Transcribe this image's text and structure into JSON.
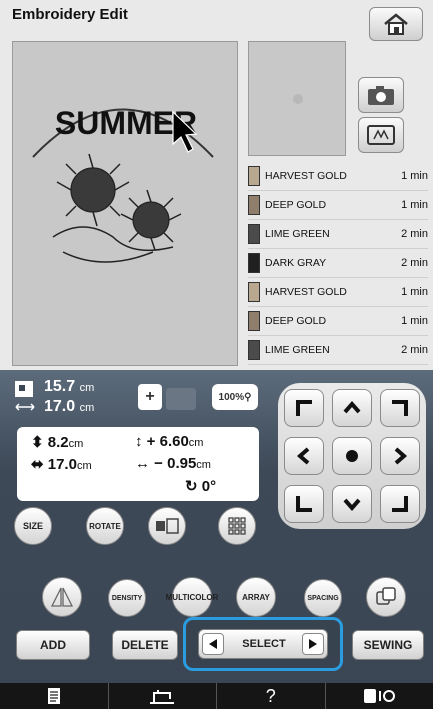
{
  "header": {
    "title": "Embroidery Edit"
  },
  "canvas": {
    "design_text": "SUMMER"
  },
  "threads": [
    {
      "name": "HARVEST GOLD",
      "time": "1 min",
      "color": "#b9a890"
    },
    {
      "name": "DEEP GOLD",
      "time": "1 min",
      "color": "#8e7e6b"
    },
    {
      "name": "LIME GREEN",
      "time": "2 min",
      "color": "#4b4b4b"
    },
    {
      "name": "DARK GRAY",
      "time": "2 min",
      "color": "#202020"
    },
    {
      "name": "HARVEST GOLD",
      "time": "1 min",
      "color": "#b9a890"
    },
    {
      "name": "DEEP GOLD",
      "time": "1 min",
      "color": "#8e7e6b"
    },
    {
      "name": "LIME GREEN",
      "time": "2 min",
      "color": "#4b4b4b"
    }
  ],
  "size_info": {
    "height_value": "15.7",
    "width_value": "17.0",
    "unit": "cm",
    "zoom": "100%"
  },
  "dimensions": {
    "height_value": "8.2",
    "width_value": "17.0",
    "unit": "cm",
    "v_offset": "+ 6.60",
    "h_offset": "− 0.95",
    "angle": "0°"
  },
  "buttons": {
    "size": "SIZE",
    "rotate": "ROTATE",
    "density": "DENSITY",
    "multi_color_1": "MULTI",
    "multi_color_2": "COLOR",
    "array": "ARRAY",
    "spacing": "SPACING",
    "add": "ADD",
    "delete": "DELETE",
    "select": "SELECT",
    "sewing": "SEWING"
  },
  "footer": {
    "help": "?"
  },
  "colors": {
    "accent": "#2b9ce0",
    "panel": "#3d4957"
  }
}
